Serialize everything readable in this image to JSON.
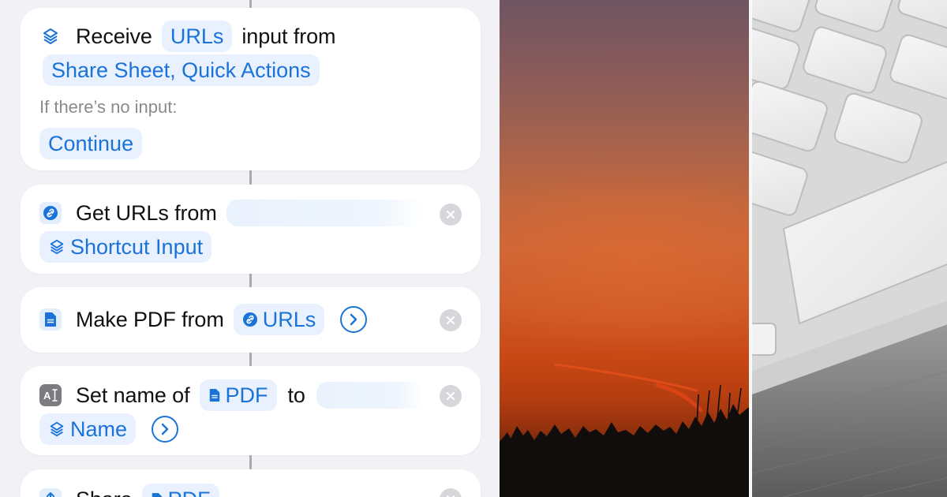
{
  "shortcut": {
    "receive": {
      "label": "Receive",
      "type_token": "URLs",
      "mid_label": "input from",
      "source_token": "Share Sheet, Quick Actions",
      "no_input_label": "If there’s no input:",
      "no_input_action": "Continue"
    },
    "get_urls": {
      "label": "Get URLs from",
      "input_token": "Shortcut Input"
    },
    "make_pdf": {
      "label": "Make PDF from",
      "input_token": "URLs"
    },
    "set_name": {
      "label": "Set name of",
      "target_token": "PDF",
      "mid_label": "to",
      "name_token": "Name"
    },
    "share": {
      "label": "Share",
      "input_token": "PDF"
    }
  },
  "colors": {
    "accent": "#1a73d9",
    "token_bg": "#e8f1fd",
    "canvas_bg": "#f1f1f6"
  },
  "icons": {
    "receive": "layers-icon",
    "get_urls": "link-icon",
    "make_pdf": "document-icon",
    "set_name": "text-cursor-icon",
    "remove": "close-icon",
    "expand": "chevron-right-icon"
  }
}
